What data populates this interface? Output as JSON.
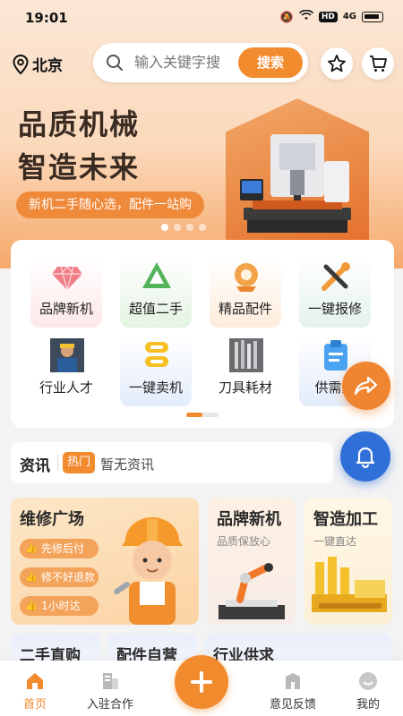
{
  "status_bar": {
    "time": "19:01",
    "hd": "HD",
    "net": "4G"
  },
  "header": {
    "location": "北京",
    "search_placeholder": "输入关键字搜",
    "search_button": "搜索"
  },
  "banner": {
    "title_line1": "品质机械",
    "title_line2": "智造未来",
    "slogan": "新机二手随心选，配件一站购"
  },
  "categories": [
    {
      "label": "品牌新机",
      "icon": "diamond-icon"
    },
    {
      "label": "超值二手",
      "icon": "recycle-triangle-icon"
    },
    {
      "label": "精品配件",
      "icon": "gear-part-icon"
    },
    {
      "label": "一键报修",
      "icon": "wrench-tools-icon"
    },
    {
      "label": "行业人才",
      "icon": "worker-photo-icon"
    },
    {
      "label": "一键卖机",
      "icon": "coin-stack-icon"
    },
    {
      "label": "刀具耗材",
      "icon": "cutting-tools-photo-icon"
    },
    {
      "label": "供需大",
      "icon": "clipboard-icon"
    }
  ],
  "news": {
    "title": "资讯",
    "hot_tag": "热门",
    "text": "暂无资讯"
  },
  "feature_cards": {
    "repair": {
      "title": "维修广场",
      "tags": [
        "先修后付",
        "修不好退款",
        "1小时达"
      ]
    },
    "brand": {
      "title": "品牌新机",
      "subtitle": "品质保放心"
    },
    "manufacture": {
      "title": "智造加工",
      "subtitle": "一键直达"
    }
  },
  "bottom_cards": [
    "二手直购",
    "配件自营",
    "行业供求"
  ],
  "tabbar": {
    "home": "首页",
    "join": "入驻合作",
    "feedback": "意见反馈",
    "mine": "我的"
  },
  "colors": {
    "accent": "#f28a2e",
    "blue": "#2f6fd8"
  }
}
